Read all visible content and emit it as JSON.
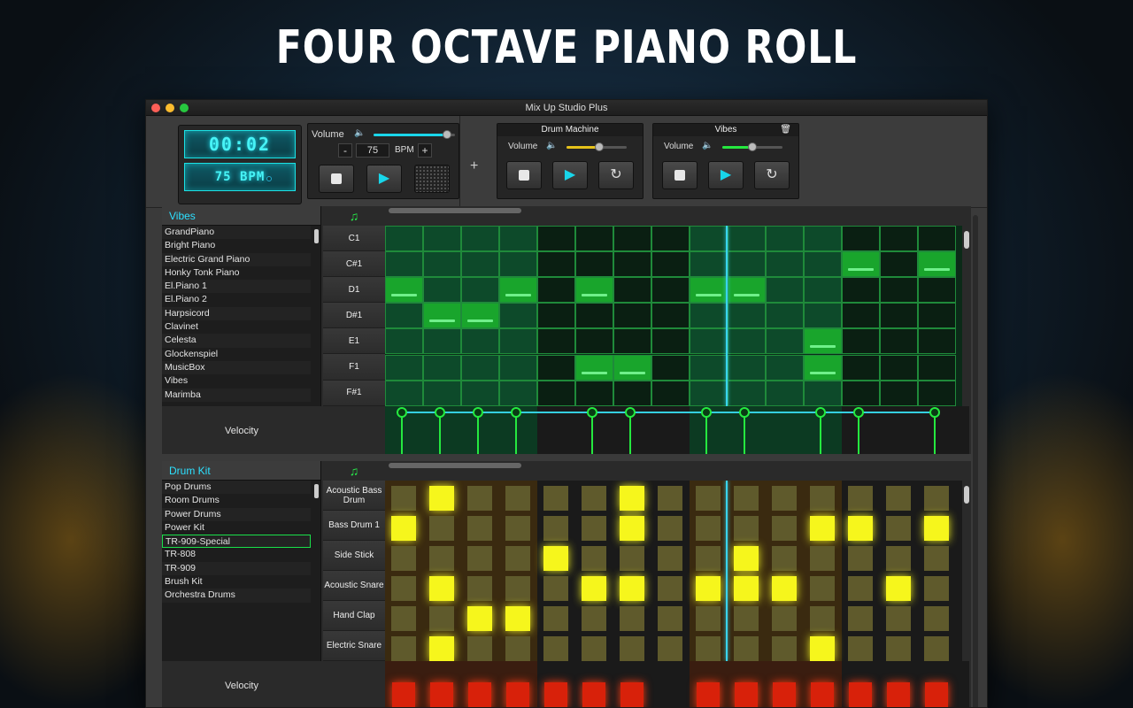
{
  "headline": "FOUR OCTAVE PIANO ROLL",
  "window": {
    "title": "Mix Up Studio Plus"
  },
  "transport": {
    "time": "00:02",
    "bpm_display": "75 BPM",
    "volume_label": "Volume",
    "volume_level": 0.9,
    "bpm_value": "75",
    "bpm_label": "BPM",
    "minus": "-",
    "plus": "+"
  },
  "add_track": "+",
  "drum_machine": {
    "title": "Drum Machine",
    "volume_label": "Volume",
    "volume_level": 0.55
  },
  "vibes_panel": {
    "title": "Vibes",
    "volume_label": "Volume",
    "volume_level": 0.5
  },
  "colors": {
    "accent": "#2de0ff",
    "piano_note": "#1fb82a",
    "drum_on": "#f5f51a",
    "velocity_drum": "#d8210a"
  },
  "piano": {
    "instrument": "Vibes",
    "instruments": [
      "GrandPiano",
      "Bright Piano",
      "Electric Grand Piano",
      "Honky Tonk Piano",
      "El.Piano 1",
      "El.Piano 2",
      "Harpsicord",
      "Clavinet",
      "Celesta",
      "Glockenspiel",
      "MusicBox",
      "Vibes",
      "Marimba"
    ],
    "keys": [
      "C1",
      "C#1",
      "D1",
      "D#1",
      "E1",
      "F1",
      "F#1"
    ],
    "notes": [
      [
        0,
        2
      ],
      [
        1,
        3
      ],
      [
        2,
        3
      ],
      [
        3,
        2
      ],
      [
        5,
        2
      ],
      [
        5,
        5
      ],
      [
        6,
        5
      ],
      [
        8,
        2
      ],
      [
        9,
        2
      ],
      [
        11,
        4
      ],
      [
        11,
        5
      ],
      [
        12,
        1
      ],
      [
        14,
        1
      ]
    ],
    "velocity_label": "Velocity",
    "velocity_steps": [
      0,
      1,
      2,
      3,
      5,
      6,
      8,
      9,
      11,
      12,
      14
    ]
  },
  "drums": {
    "kit": "Drum Kit",
    "kits": [
      "Pop Drums",
      "Room Drums",
      "Power Drums",
      "Power Kit",
      "TR-909-Special",
      "TR-808",
      "TR-909",
      "Brush Kit",
      "Orchestra Drums"
    ],
    "selected_kit": "TR-909-Special",
    "rows": [
      "Acoustic Bass Drum",
      "Bass Drum 1",
      "Side Stick",
      "Acoustic Snare",
      "Hand Clap",
      "Electric Snare"
    ],
    "hits": [
      [
        1,
        0
      ],
      [
        6,
        0
      ],
      [
        0,
        1
      ],
      [
        6,
        1
      ],
      [
        11,
        1
      ],
      [
        12,
        1
      ],
      [
        14,
        1
      ],
      [
        4,
        2
      ],
      [
        9,
        2
      ],
      [
        1,
        3
      ],
      [
        5,
        3
      ],
      [
        6,
        3
      ],
      [
        8,
        3
      ],
      [
        9,
        3
      ],
      [
        10,
        3
      ],
      [
        13,
        3
      ],
      [
        2,
        4
      ],
      [
        3,
        4
      ],
      [
        1,
        5
      ],
      [
        11,
        5
      ]
    ],
    "velocity_label": "Velocity",
    "velocity_steps": [
      0,
      1,
      2,
      3,
      4,
      5,
      6,
      8,
      9,
      10,
      11,
      12,
      13,
      14
    ]
  }
}
